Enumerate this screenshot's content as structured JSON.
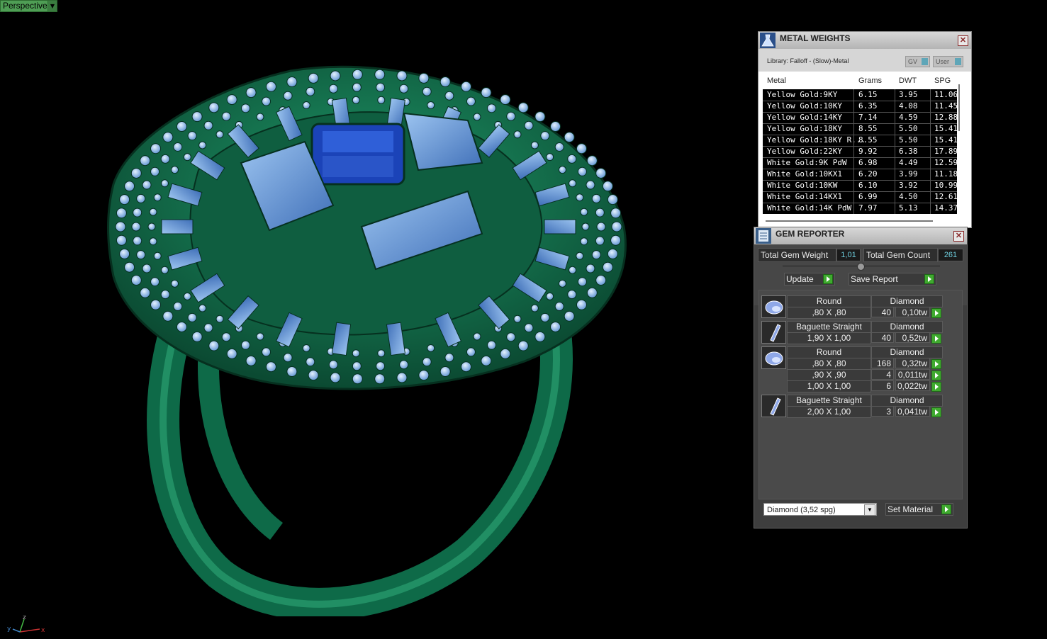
{
  "viewport": {
    "label": "Perspective"
  },
  "axis": {
    "x": "x",
    "y": "y",
    "z": "z"
  },
  "metal_weights": {
    "title": "METAL WEIGHTS",
    "library": "Library: Falloff - (Slow)-Metal",
    "btn_gv": "GV",
    "btn_user": "User",
    "columns": [
      "Metal",
      "Grams",
      "DWT",
      "SPG"
    ],
    "rows": [
      [
        "Yellow Gold:9KY",
        "6.15",
        "3.95",
        "11.06"
      ],
      [
        "Yellow Gold:10KY",
        "6.35",
        "4.08",
        "11.45"
      ],
      [
        "Yellow Gold:14KY",
        "7.14",
        "4.59",
        "12.88"
      ],
      [
        "Yellow Gold:18KY",
        "8.55",
        "5.50",
        "15.41"
      ],
      [
        "Yellow Gold:18KY R...",
        "8.55",
        "5.50",
        "15.41"
      ],
      [
        "Yellow Gold:22KY",
        "9.92",
        "6.38",
        "17.89"
      ],
      [
        "White Gold:9K PdW",
        "6.98",
        "4.49",
        "12.59"
      ],
      [
        "White Gold:10KX1",
        "6.20",
        "3.99",
        "11.18"
      ],
      [
        "White Gold:10KW",
        "6.10",
        "3.92",
        "10.99"
      ],
      [
        "White Gold:14KX1",
        "6.99",
        "4.50",
        "12.61"
      ],
      [
        "White Gold:14K PdW",
        "7.97",
        "5.13",
        "14.37"
      ]
    ]
  },
  "gem_reporter": {
    "title": "GEM REPORTER",
    "total_weight_label": "Total Gem Weight",
    "total_weight_value": "1,01",
    "total_count_label": "Total Gem Count",
    "total_count_value": "261",
    "update_label": "Update",
    "save_label": "Save Report",
    "groups": [
      {
        "shape": "Round",
        "material": "Diamond",
        "rows": [
          [
            ",80 X ,80",
            "40",
            "0,10tw"
          ]
        ]
      },
      {
        "shape": "Baguette Straight",
        "material": "Diamond",
        "rows": [
          [
            "1,90 X 1,00",
            "40",
            "0,52tw"
          ]
        ]
      },
      {
        "shape": "Round",
        "material": "Diamond",
        "rows": [
          [
            ",80 X ,80",
            "168",
            "0,32tw"
          ],
          [
            ",90 X ,90",
            "4",
            "0,011tw"
          ],
          [
            "1,00 X 1,00",
            "6",
            "0,022tw"
          ]
        ]
      },
      {
        "shape": "Baguette Straight",
        "material": "Diamond",
        "rows": [
          [
            "2,00 X 1,00",
            "3",
            "0,041tw"
          ]
        ]
      }
    ],
    "material_select": "Diamond     (3,52 spg)",
    "set_material_label": "Set Material"
  }
}
